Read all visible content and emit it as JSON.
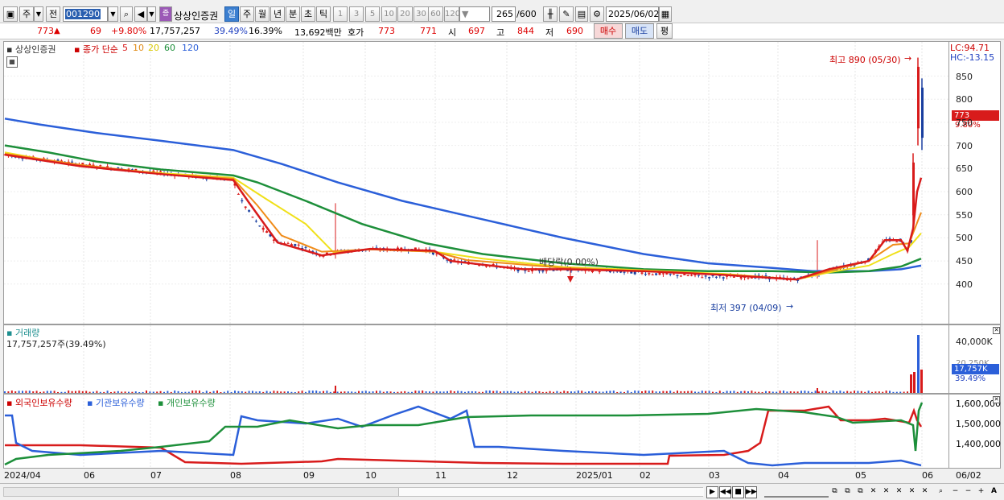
{
  "toolbar": {
    "period": "주",
    "prev": "전",
    "code": "001290",
    "stock_name": "상상인증권",
    "tabs": [
      "일",
      "주",
      "월",
      "년",
      "분",
      "초",
      "틱"
    ],
    "active_tab": "일",
    "intervals": [
      "1",
      "3",
      "5",
      "10",
      "20",
      "30",
      "60",
      "120"
    ],
    "count": "265",
    "max_count": "/600",
    "date": "2025/06/02"
  },
  "quote": {
    "price": "773",
    "arrow": "▲",
    "change": "69",
    "change_pct": "+9.80%",
    "volume": "17,757,257",
    "vol_ratio": "39.49%",
    "turnover": "16.39%",
    "amount": "13,692백만",
    "hoga_label": "호가",
    "ask": "773",
    "bid": "771",
    "open_label": "시",
    "open": "697",
    "high_label": "고",
    "high": "844",
    "low_label": "저",
    "low": "690",
    "buy": "매수",
    "sell": "매도",
    "eval": "평"
  },
  "price_pane": {
    "stock_label": "상상인증권",
    "ma_label": "종가 단순",
    "ma_periods": [
      "5",
      "10",
      "20",
      "60",
      "120"
    ],
    "ma_colors": [
      "#d81b1b",
      "#f08c1a",
      "#f0e019",
      "#1d8f3a",
      "#2b5fd9"
    ],
    "lc": "LC:94.71",
    "hc": "HC:-13.15",
    "price_tag": "773",
    "pct_tag": "9.80%",
    "high_note": "최고 890 (05/30)",
    "low_note": "최저 397 (04/09)",
    "div_note": "배당락(0.00%)",
    "y_ticks": [
      "850",
      "800",
      "750",
      "700",
      "650",
      "600",
      "550",
      "500",
      "450",
      "400"
    ]
  },
  "volume_pane": {
    "title": "거래량",
    "value": "17,757,257주(39.49%)",
    "tick": "40,000K",
    "tag": "17,757K",
    "tag_pct": "39.49%",
    "faded": "20,250K"
  },
  "holding_pane": {
    "series": [
      "외국인보유수량",
      "기관보유수량",
      "개인보유수량"
    ],
    "colors": [
      "#d81b1b",
      "#2b5fd9",
      "#1d8f3a"
    ],
    "ticks": [
      "1,600,000",
      "1,500,000",
      "1,400,000"
    ]
  },
  "x_axis": [
    "2024/04",
    "06",
    "07",
    "08",
    "09",
    "10",
    "11",
    "12",
    "2025/01",
    "02",
    "03",
    "04",
    "05",
    "06",
    "06/02"
  ]
}
